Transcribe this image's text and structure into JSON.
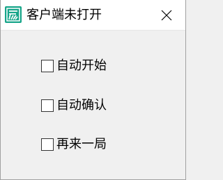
{
  "window": {
    "title": "客户端未打开",
    "icon": "app-logo-icon",
    "close_icon": "close-icon",
    "accent_color": "#17a589"
  },
  "options": [
    {
      "label": "自动开始",
      "checked": false
    },
    {
      "label": "自动确认",
      "checked": false
    },
    {
      "label": "再来一局",
      "checked": false
    }
  ]
}
